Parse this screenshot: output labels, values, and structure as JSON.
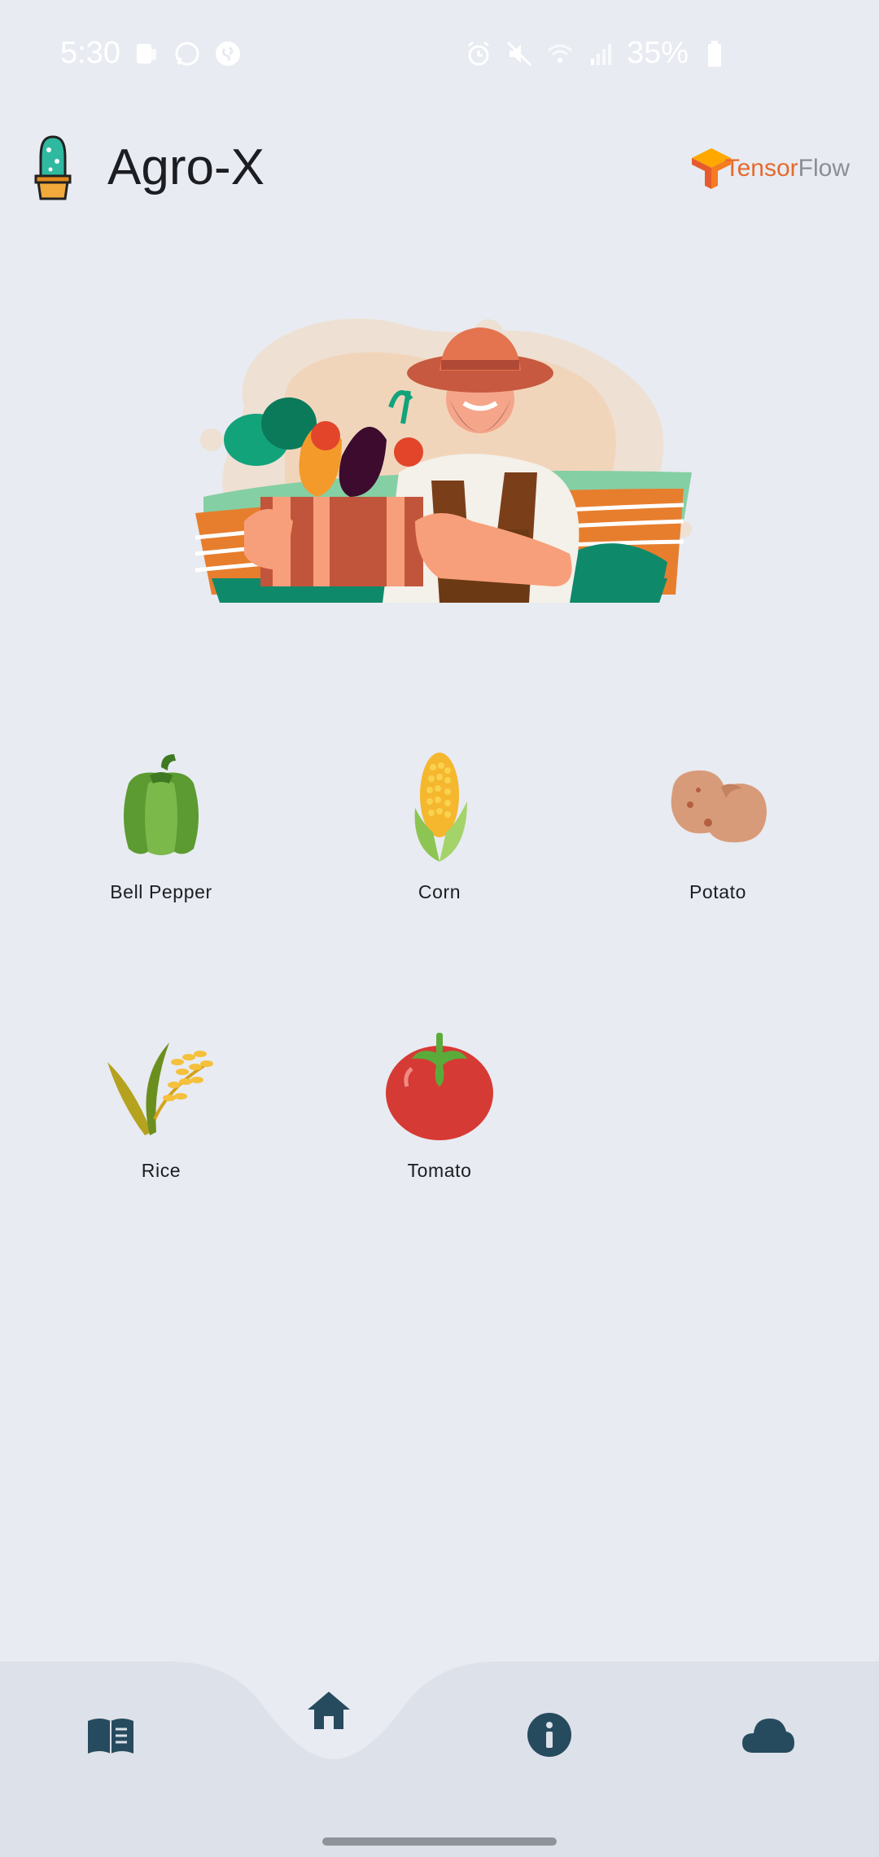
{
  "status_bar": {
    "time": "5:30",
    "battery": "35%"
  },
  "app": {
    "title": "Agro-X",
    "tf_brand_a": "Tensor",
    "tf_brand_b": "Flow"
  },
  "crops": [
    {
      "label": "Bell Pepper",
      "icon": "bell-pepper-icon"
    },
    {
      "label": "Corn",
      "icon": "corn-icon"
    },
    {
      "label": "Potato",
      "icon": "potato-icon"
    },
    {
      "label": "Rice",
      "icon": "rice-icon"
    },
    {
      "label": "Tomato",
      "icon": "tomato-icon"
    }
  ],
  "bottom_nav": {
    "items": [
      {
        "icon": "book-icon"
      },
      {
        "icon": "home-icon",
        "active": true
      },
      {
        "icon": "info-icon"
      },
      {
        "icon": "cloud-icon"
      }
    ],
    "accent": "#274b5e"
  }
}
